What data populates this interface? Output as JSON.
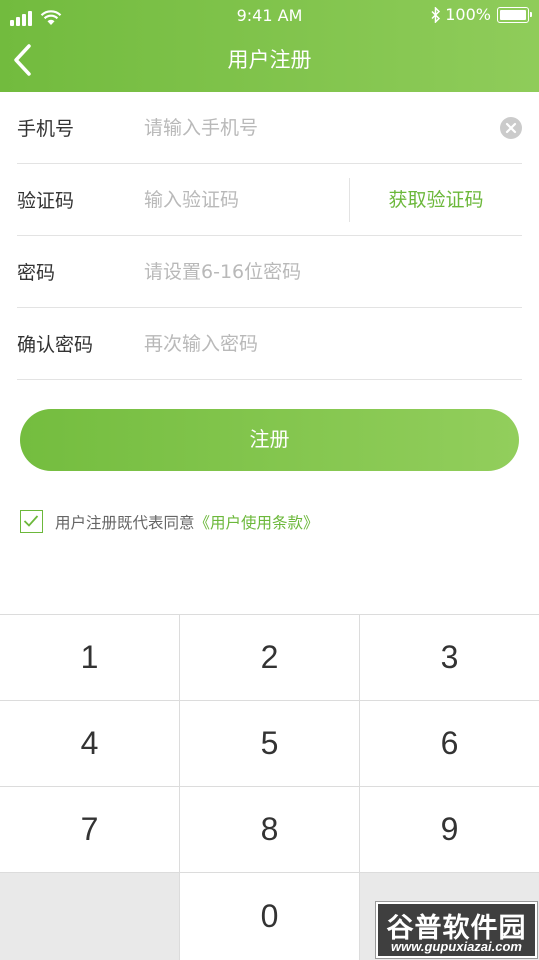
{
  "status_bar": {
    "time": "9:41 AM",
    "battery": "100%"
  },
  "header": {
    "title": "用户注册"
  },
  "form": {
    "phone": {
      "label": "手机号",
      "placeholder": "请输入手机号"
    },
    "code": {
      "label": "验证码",
      "placeholder": "输入验证码",
      "get_code": "获取验证码"
    },
    "password": {
      "label": "密码",
      "placeholder": "请设置6-16位密码"
    },
    "confirm": {
      "label": "确认密码",
      "placeholder": "再次输入密码"
    }
  },
  "register_button": "注册",
  "agreement": {
    "text": "用户注册既代表同意",
    "link": "《用户使用条款》",
    "checked": true
  },
  "keypad": {
    "keys": [
      "1",
      "2",
      "3",
      "4",
      "5",
      "6",
      "7",
      "8",
      "9",
      "0"
    ]
  },
  "watermark": {
    "name": "谷普软件园",
    "url": "www.gupuxiazai.com"
  },
  "colors": {
    "accent": "#6cb83b",
    "header_start": "#72bb3e",
    "header_end": "#8fcc5a"
  }
}
